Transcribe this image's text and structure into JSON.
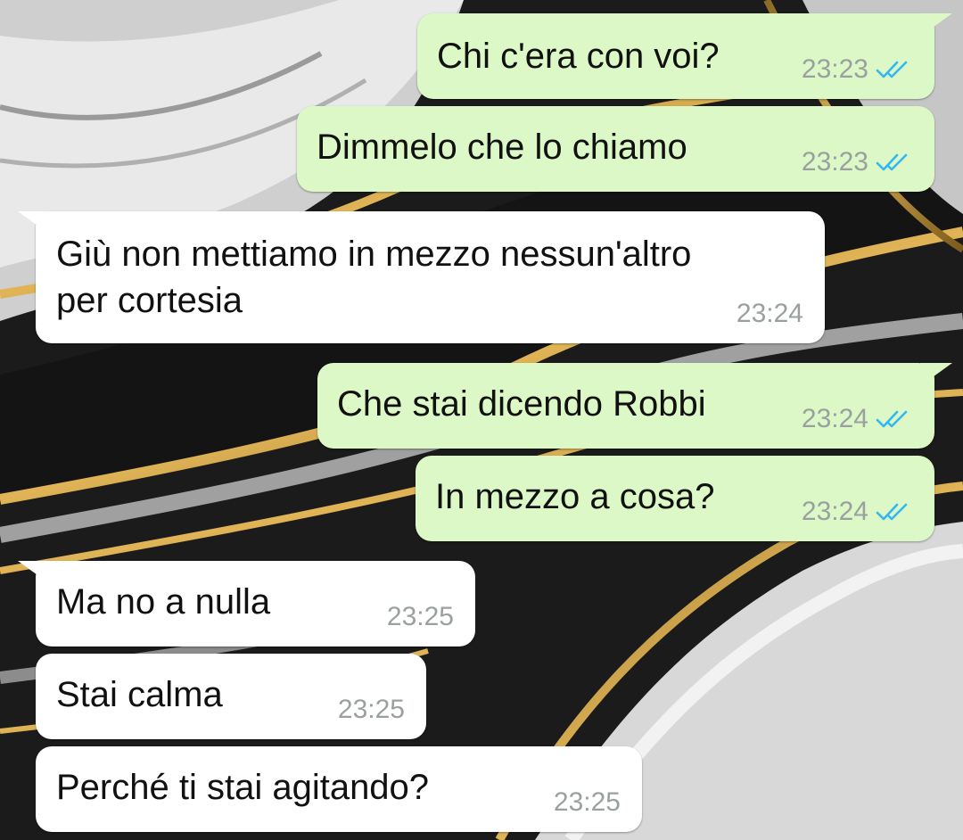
{
  "colors": {
    "outgoing_bubble": "#dcf8c6",
    "incoming_bubble": "#ffffff",
    "read_ticks": "#34b7f1",
    "timestamp": "#9aa0a0"
  },
  "messages": [
    {
      "direction": "out",
      "text": "Chi c'era con voi?",
      "time": "23:23",
      "status": "read-ticks-icon"
    },
    {
      "direction": "out",
      "text": "Dimmelo che lo chiamo",
      "time": "23:23",
      "status": "read-ticks-icon"
    },
    {
      "direction": "in",
      "text": "Giù non mettiamo in mezzo nessun'altro\nper cortesia",
      "time": "23:24"
    },
    {
      "direction": "out",
      "text": "Che stai dicendo Robbi",
      "time": "23:24",
      "status": "read-ticks-icon"
    },
    {
      "direction": "out",
      "text": "In mezzo a cosa?",
      "time": "23:24",
      "status": "read-ticks-icon"
    },
    {
      "direction": "in",
      "text": "Ma no a nulla",
      "time": "23:25"
    },
    {
      "direction": "in",
      "text": "Stai calma",
      "time": "23:25"
    },
    {
      "direction": "in",
      "text": "Perché ti stai agitando?",
      "time": "23:25"
    }
  ]
}
